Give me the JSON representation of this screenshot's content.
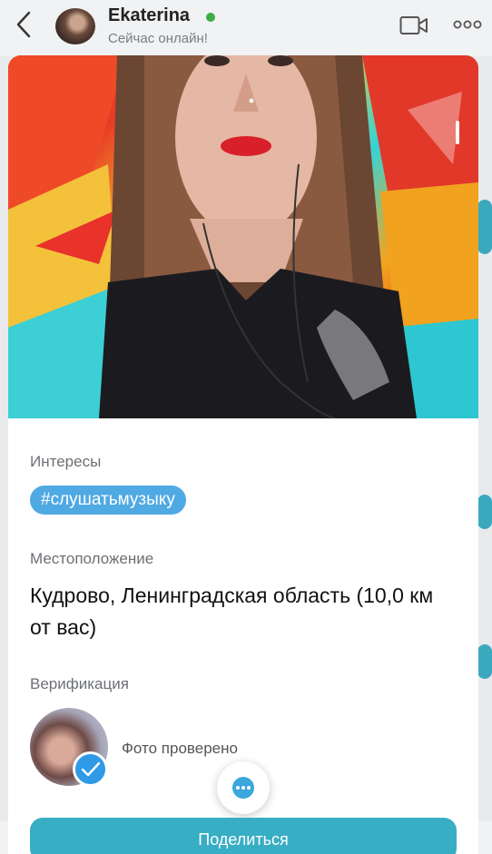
{
  "header": {
    "name": "Ekaterina",
    "status": "Сейчас онлайн!",
    "online_color": "#3cae48"
  },
  "profile": {
    "interests_label": "Интересы",
    "interests": [
      "#слушатьмузыку"
    ],
    "location_label": "Местоположение",
    "location_value": "Кудрово, Ленинградская область (10,0 км от вас)",
    "verification_label": "Верификация",
    "verification_status": "Фото проверено",
    "share_label": "Поделиться"
  },
  "icons": {
    "back": "back-arrow-icon",
    "video": "video-camera-icon",
    "more": "more-dots-icon",
    "check": "checkmark-icon",
    "chat": "chat-bubble-icon"
  },
  "colors": {
    "accent": "#38aec4",
    "tag": "#4fa9e3",
    "verify": "#2f9ae6"
  }
}
